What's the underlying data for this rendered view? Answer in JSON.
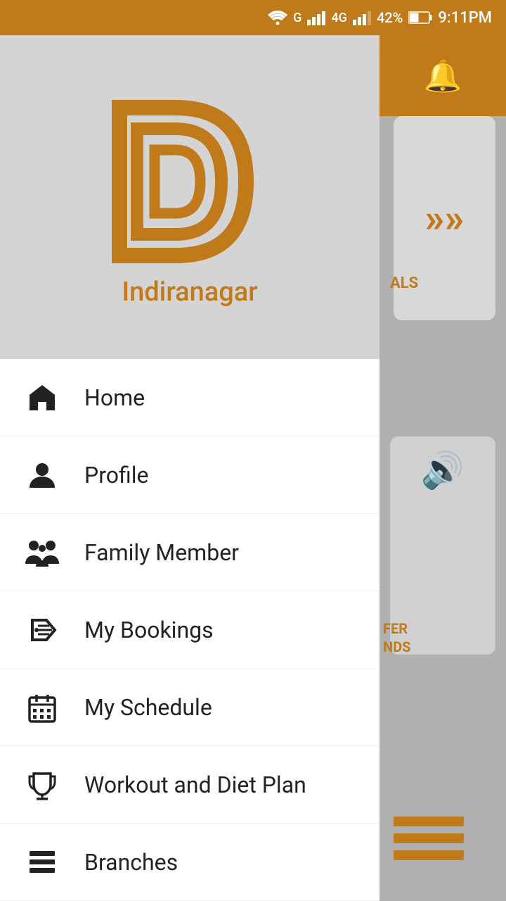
{
  "statusBar": {
    "wifi": "wifi-icon",
    "signal": "signal-icon",
    "battery": "42%",
    "time": "9:11PM"
  },
  "drawer": {
    "branchName": "Indiranagar",
    "menuItems": [
      {
        "id": "home",
        "label": "Home",
        "icon": "home-icon"
      },
      {
        "id": "profile",
        "label": "Profile",
        "icon": "person-icon"
      },
      {
        "id": "family-member",
        "label": "Family Member",
        "icon": "family-icon"
      },
      {
        "id": "my-bookings",
        "label": "My Bookings",
        "icon": "tag-icon"
      },
      {
        "id": "my-schedule",
        "label": "My Schedule",
        "icon": "calendar-icon"
      },
      {
        "id": "workout-diet",
        "label": "Workout and Diet Plan",
        "icon": "trophy-icon"
      },
      {
        "id": "branches",
        "label": "Branches",
        "icon": "list-icon"
      }
    ]
  },
  "rightPanel": {
    "text1": "ALS",
    "text2": "FER\nNDS"
  },
  "colors": {
    "orange": "#c17a1a",
    "headerOrange": "#c17a1a",
    "drawerBg": "#d4d4d4",
    "white": "#ffffff"
  }
}
